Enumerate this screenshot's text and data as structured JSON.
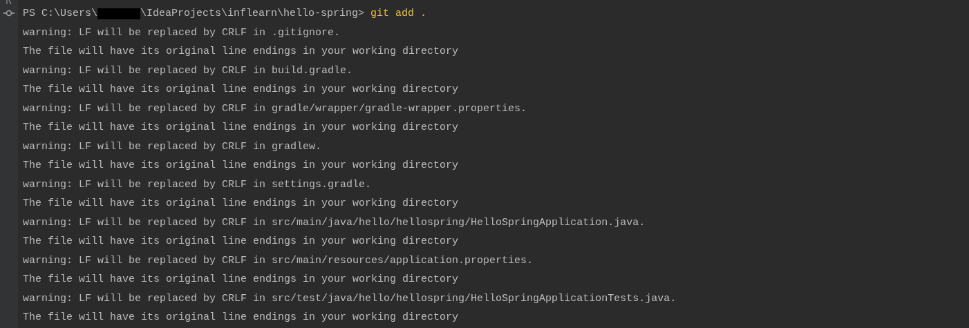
{
  "prompt": {
    "path_start": "PS C:\\Users\\",
    "path_end": "\\IdeaProjects\\inflearn\\hello-spring> ",
    "command": "git add ."
  },
  "output_lines": [
    "warning: LF will be replaced by CRLF in .gitignore.",
    "The file will have its original line endings in your working directory",
    "warning: LF will be replaced by CRLF in build.gradle.",
    "The file will have its original line endings in your working directory",
    "warning: LF will be replaced by CRLF in gradle/wrapper/gradle-wrapper.properties.",
    "The file will have its original line endings in your working directory",
    "warning: LF will be replaced by CRLF in gradlew.",
    "The file will have its original line endings in your working directory",
    "warning: LF will be replaced by CRLF in settings.gradle.",
    "The file will have its original line endings in your working directory",
    "warning: LF will be replaced by CRLF in src/main/java/hello/hellospring/HelloSpringApplication.java.",
    "The file will have its original line endings in your working directory",
    "warning: LF will be replaced by CRLF in src/main/resources/application.properties.",
    "The file will have its original line endings in your working directory",
    "warning: LF will be replaced by CRLF in src/test/java/hello/hellospring/HelloSpringApplicationTests.java.",
    "The file will have its original line endings in your working directory"
  ]
}
